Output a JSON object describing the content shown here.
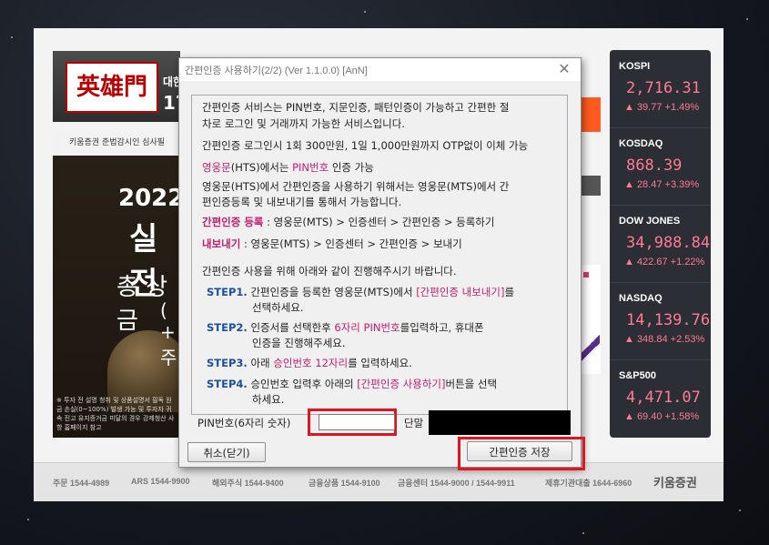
{
  "launcher": {
    "logo_mark": "英雄門",
    "logo_text": "대한",
    "logo_num": "17",
    "banner_top": "키움증권 준법감시인 심사필",
    "banner_year": "2022",
    "banner_title": "실전",
    "banner_prize": "총 상금",
    "banner_sub": "( + 주",
    "banner_note": "※ 투자 전 설명 청취 및 상품설명서 필독 원금 손실(0~100%) 발생 가능 및 투자자 귀속 진고 유지증거금 미달의 경우 강제청산 사항 홈페이지 참고"
  },
  "indices": [
    {
      "name": "KOSPI",
      "value": "2,716.31",
      "change": "▲ 39.77  +1.49%"
    },
    {
      "name": "KOSDAQ",
      "value": "868.39",
      "change": "▲ 28.47  +3.39%"
    },
    {
      "name": "DOW JONES",
      "value": "34,988.84",
      "change": "▲ 422.67  +1.22%"
    },
    {
      "name": "NASDAQ",
      "value": "14,139.76",
      "change": "▲ 348.84  +2.53%"
    },
    {
      "name": "S&P500",
      "value": "4,471.07",
      "change": "▲ 69.40  +1.58%"
    }
  ],
  "phonebar": {
    "order": "주문 1544-4989",
    "ars": "ARS 1544-9900",
    "overseas": "해외주식 1544-9400",
    "finance": "금융상품 1544-9100",
    "center": "금융센터 1544-9000 / 1544-9911",
    "loan": "제휴기관대출 1644-6960",
    "brand": "키움증권"
  },
  "dialog": {
    "title": "간편인증 사용하기(2/2) (Ver 1.1.0.0)  [AnN]",
    "close": "✕",
    "l1": "간편인증 서비스는 PIN번호, 지문인증, 패턴인증이 가능하고 간편한 절",
    "l2": "차로 로그인 및 거래까지 가능한 서비스입니다.",
    "l3": "간편인증 로그인시 1회 300만원, 1일 1,000만원까지 OTP없이 이체 가능",
    "l4a": "영웅문",
    "l4b": "(HTS)에서는 ",
    "l4c": "PIN번호",
    "l4d": " 인증 가능",
    "l5": "영웅문(HTS)에서 간편인증을 사용하기 위해서는 영웅문(MTS)에서 간",
    "l6": "편인증등록 및 내보내기를 통해서 가능합니다.",
    "l7a": "간편인증 등록",
    "l7b": " : 영웅문(MTS) > 인증센터 > 간편인증 > 등록하기",
    "l8a": "내보내기",
    "l8b": " : 영웅문(MTS) > 인증센터 > 간편인증 > 보내기",
    "l9": "간편인증 사용을 위해 아래와 같이 진행해주시기 바랍니다.",
    "s1": "STEP1.",
    "s1a": " 간편인증을 등록한 영웅문(MTS)에서 ",
    "s1b": "[간편인증 내보내기]",
    "s1c": "를",
    "s1d": "선택하세요.",
    "s2": "STEP2.",
    "s2a": " 인증서를 선택한후 ",
    "s2b": "6자리 PIN번호",
    "s2c": "를입력하고, 휴대폰",
    "s2d": "인증을 진행해주세요.",
    "s3": "STEP3.",
    "s3a": " 아래 ",
    "s3b": "승인번호 12자리",
    "s3c": "를 입력하세요.",
    "s4": "STEP4.",
    "s4a": " 승인번호 입력후 아래의 ",
    "s4b": "[간편인증 사용하기]",
    "s4c": "버튼을 선택",
    "s4d": "하세요.",
    "pin_label": "PIN번호(6자리 숫자)",
    "pin_value": "",
    "otp_label": "단말",
    "cancel": "취소(닫기)",
    "save": "간편인증 저장"
  }
}
